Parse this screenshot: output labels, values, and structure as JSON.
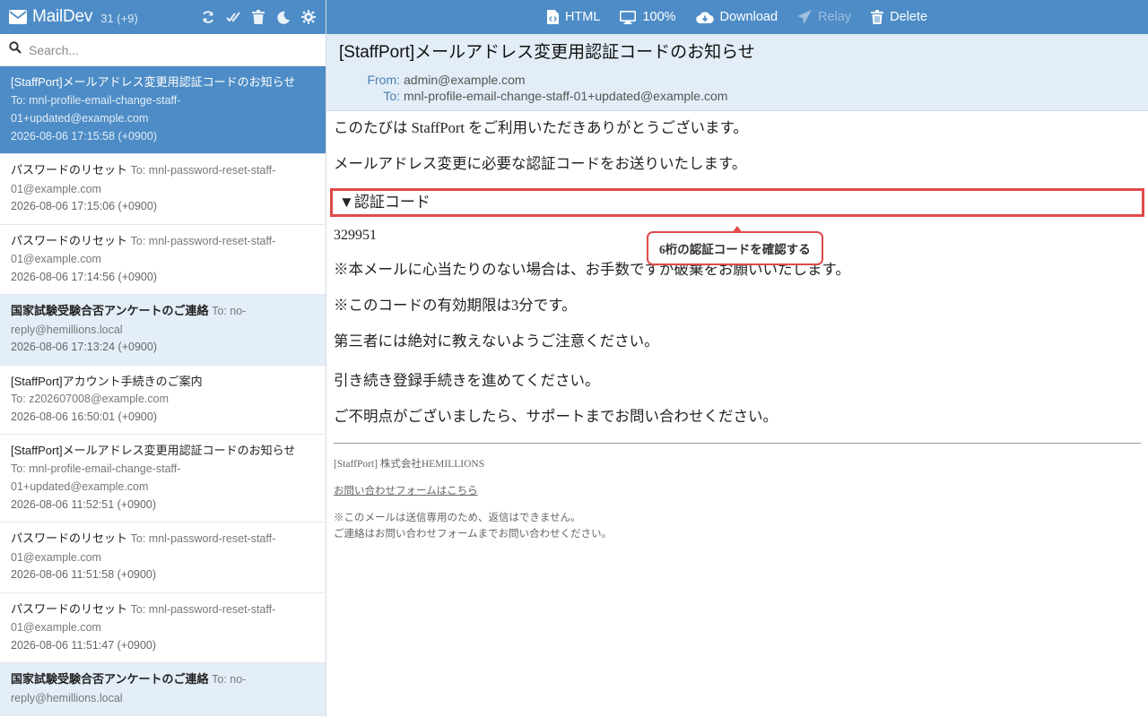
{
  "app": {
    "name": "MailDev",
    "count": "31 (+9)"
  },
  "search": {
    "placeholder": "Search..."
  },
  "header_tools": [
    "refresh-icon",
    "mark-read-icon",
    "trash-icon",
    "moon-icon",
    "gear-icon"
  ],
  "mail_list": [
    {
      "subject": "[StaffPort]メールアドレス変更用認証コードのお知らせ",
      "to": "To: mnl-profile-email-change-staff-01+updated@example.com",
      "date": "2026-08-06 17:15:58 (+0900)",
      "state": "selected"
    },
    {
      "subject": "パスワードのリセット",
      "to": "To: mnl-password-reset-staff-01@example.com",
      "date": "2026-08-06 17:15:06 (+0900)",
      "state": "read"
    },
    {
      "subject": "パスワードのリセット",
      "to": "To: mnl-password-reset-staff-01@example.com",
      "date": "2026-08-06 17:14:56 (+0900)",
      "state": "read"
    },
    {
      "subject": "国家試験受験合否アンケートのご連絡",
      "to": "To: no-reply@hemillions.local",
      "date": "2026-08-06 17:13:24 (+0900)",
      "state": "unread"
    },
    {
      "subject": "[StaffPort]アカウント手続きのご案内",
      "to": "To: z202607008@example.com",
      "date": "2026-08-06 16:50:01 (+0900)",
      "state": "read"
    },
    {
      "subject": "[StaffPort]メールアドレス変更用認証コードのお知らせ",
      "to": "To: mnl-profile-email-change-staff-01+updated@example.com",
      "date": "2026-08-06 11:52:51 (+0900)",
      "state": "read"
    },
    {
      "subject": "パスワードのリセット",
      "to": "To: mnl-password-reset-staff-01@example.com",
      "date": "2026-08-06 11:51:58 (+0900)",
      "state": "read"
    },
    {
      "subject": "パスワードのリセット",
      "to": "To: mnl-password-reset-staff-01@example.com",
      "date": "2026-08-06 11:51:47 (+0900)",
      "state": "read"
    },
    {
      "subject": "国家試験受験合否アンケートのご連絡",
      "to": "To: no-reply@hemillions.local",
      "date": "",
      "state": "unread"
    }
  ],
  "toolbar": {
    "html_label": "HTML",
    "zoom_label": "100%",
    "download_label": "Download",
    "relay_label": "Relay",
    "delete_label": "Delete"
  },
  "email": {
    "subject": "[StaffPort]メールアドレス変更用認証コードのお知らせ",
    "from_label": "From:",
    "from": "admin@example.com",
    "to_label": "To:",
    "to": "mnl-profile-email-change-staff-01+updated@example.com",
    "body": {
      "intro1": "このたびは StaffPort をご利用いただきありがとうございます。",
      "intro2": "メールアドレス変更に必要な認証コードをお送りいたします。",
      "code_heading": "▼認証コード",
      "code": "329951",
      "note1": "※本メールに心当たりのない場合は、お手数ですが破棄をお願いいたします。",
      "note2": "※このコードの有効期限は3分です。",
      "note3": "第三者には絶対に教えないようご注意ください。",
      "continue": "引き続き登録手続きを進めてください。",
      "ask": "ご不明点がございましたら、サポートまでお問い合わせください。"
    },
    "footer": {
      "signature": "[StaffPort] 株式会社HEMILLIONS",
      "contact_link": "お問い合わせフォームはこちら",
      "note_line1": "※このメールは送信専用のため、返信はできません。",
      "note_line2": "ご連絡はお問い合わせフォームまでお問い合わせください。"
    }
  },
  "annotation": {
    "callout": "6桁の認証コードを確認する"
  },
  "colors": {
    "header_blue": "#4d8cc6",
    "email_header_bg": "#e2edf7",
    "unread_bg": "#e4eef8",
    "highlight_red": "#e04a4a"
  }
}
